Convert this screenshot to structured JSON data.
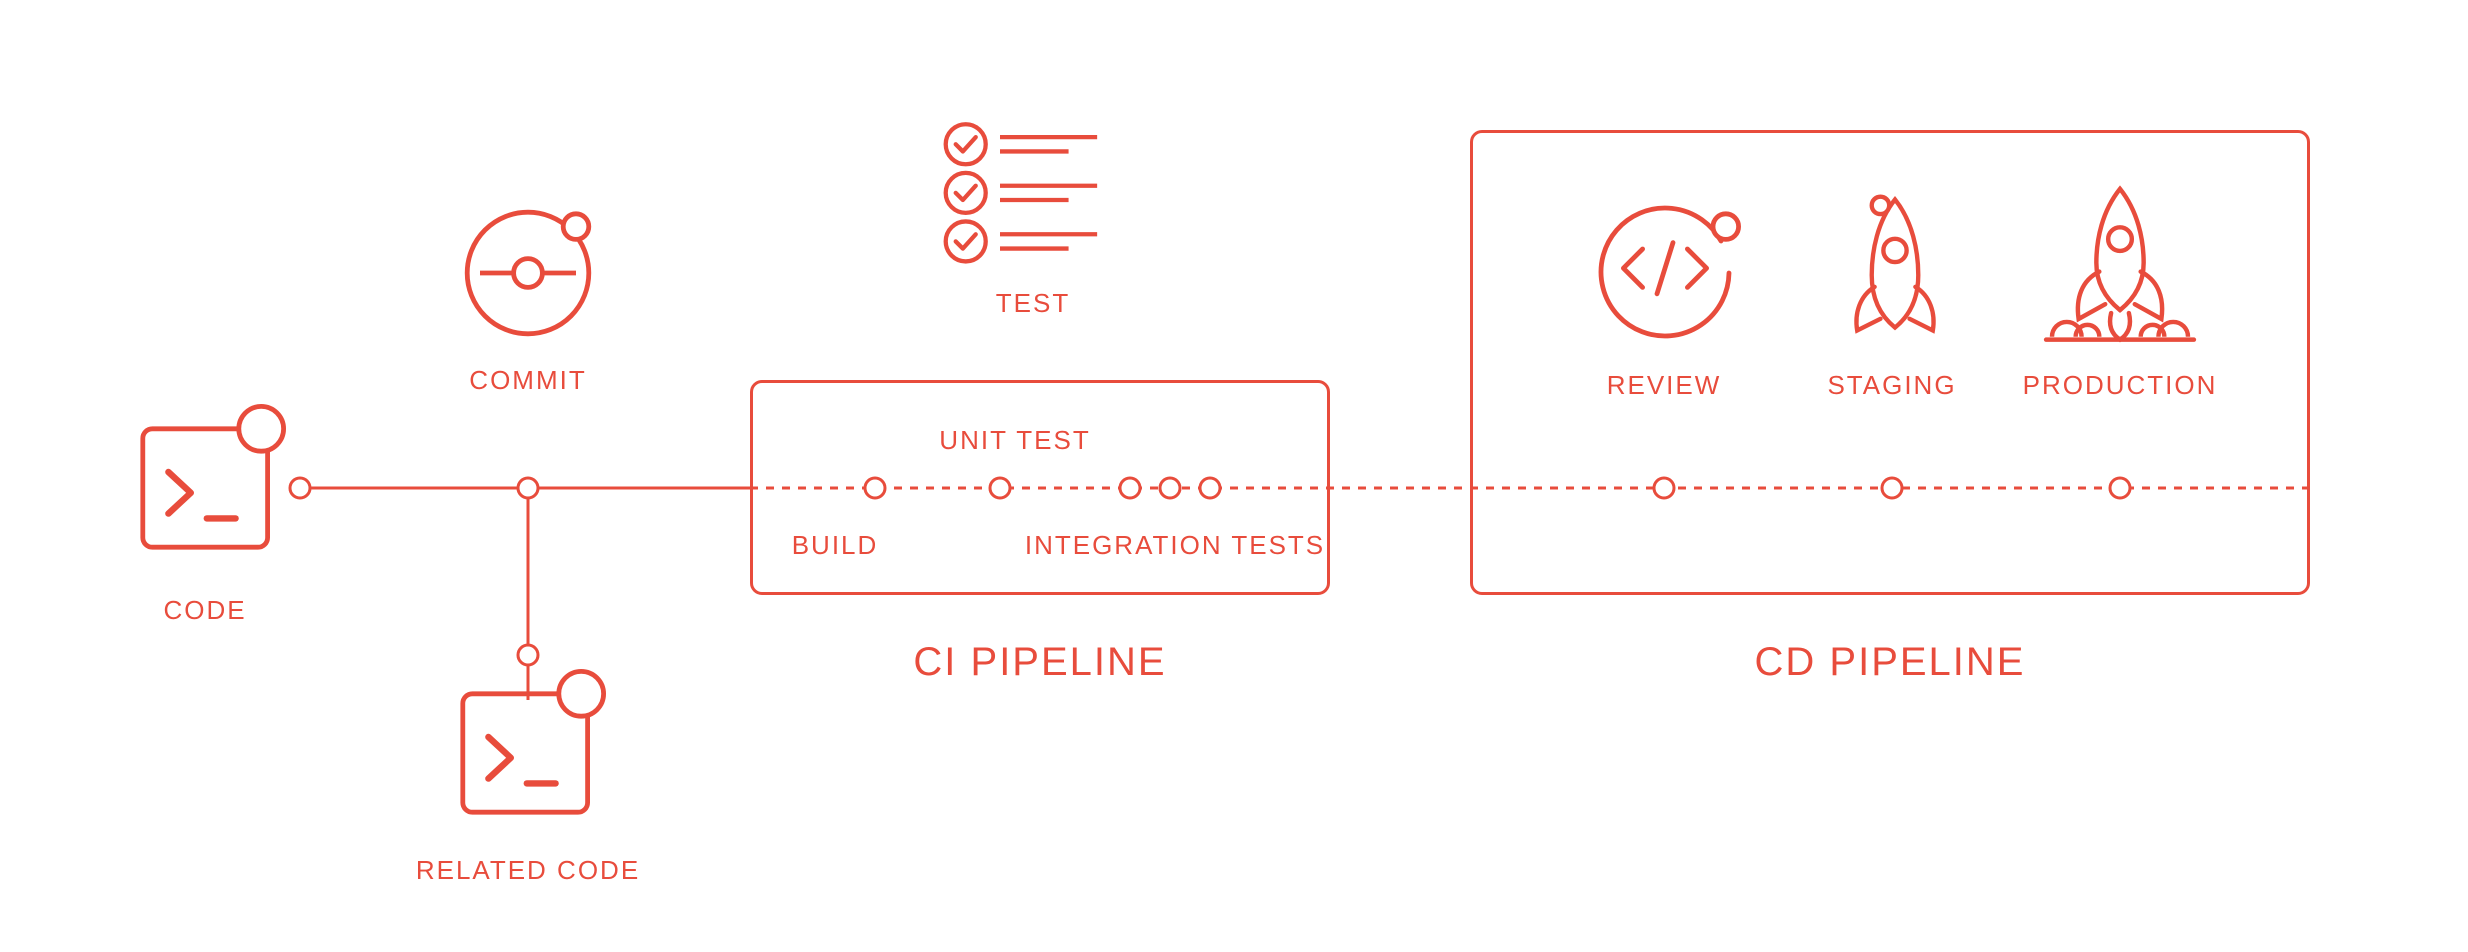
{
  "colors": {
    "accent": "#e84c3c"
  },
  "nodes": {
    "code": {
      "label": "CODE",
      "icon": "terminal-icon"
    },
    "commit": {
      "label": "COMMIT",
      "icon": "commit-icon"
    },
    "related_code": {
      "label": "RELATED CODE",
      "icon": "terminal-icon"
    },
    "test": {
      "label": "TEST",
      "icon": "checklist-icon"
    }
  },
  "ci": {
    "title": "CI PIPELINE",
    "steps": {
      "build": "BUILD",
      "unit_test": "UNIT TEST",
      "integration_tests": "INTEGRATION TESTS"
    }
  },
  "cd": {
    "title": "CD PIPELINE",
    "steps": {
      "review": {
        "label": "REVIEW",
        "icon": "code-review-icon"
      },
      "staging": {
        "label": "STAGING",
        "icon": "rocket-idle-icon"
      },
      "production": {
        "label": "PRODUCTION",
        "icon": "rocket-launch-icon"
      }
    }
  }
}
